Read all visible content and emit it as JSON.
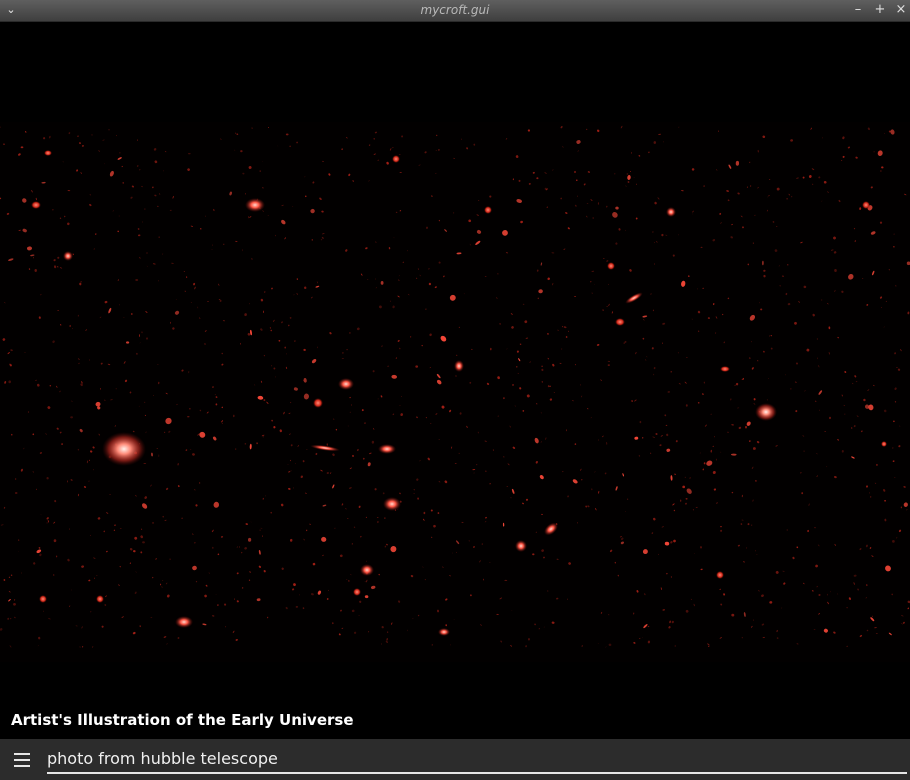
{
  "window": {
    "title": "mycroft.gui",
    "menu_icon": "chevron-down-icon",
    "controls": [
      "minimize-icon",
      "maximize-icon",
      "close-icon"
    ]
  },
  "image": {
    "subject": "space-image",
    "caption": "Artist's Illustration of the Early Universe"
  },
  "bottom_bar": {
    "menu_icon": "hamburger-menu-icon",
    "query": "photo from hubble telescope"
  },
  "colors": {
    "background": "#000000",
    "galaxy_red": "#ff4a3a",
    "bottom_bar": "#2c2c2c"
  }
}
